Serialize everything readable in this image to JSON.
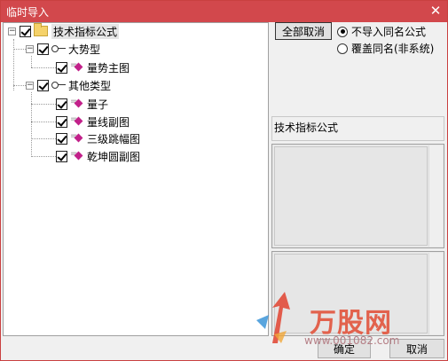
{
  "window": {
    "title": "临时导入",
    "close_glyph": "✕"
  },
  "tree": {
    "root": {
      "label": "技术指标公式",
      "checked": true,
      "expanded": true
    },
    "groups": [
      {
        "label": "大势型",
        "checked": true,
        "expanded": true,
        "items": [
          {
            "label": "量势主图",
            "checked": true
          }
        ]
      },
      {
        "label": "其他类型",
        "checked": true,
        "expanded": true,
        "items": [
          {
            "label": "量子",
            "checked": true
          },
          {
            "label": "量线副图",
            "checked": true
          },
          {
            "label": "三级跳幅图",
            "checked": true
          },
          {
            "label": "乾坤圆副图",
            "checked": true
          }
        ]
      }
    ]
  },
  "controls": {
    "deselect_all": "全部取消",
    "radio_no_import": "不导入同名公式",
    "radio_overwrite": "覆盖同名(非系统)",
    "selected_radio": "no_import",
    "info_label": "技术指标公式"
  },
  "footer": {
    "confirm": "确定",
    "cancel": "取消"
  },
  "watermark": {
    "brand": "万股网",
    "url": "www.001082.com"
  },
  "colors": {
    "titlebar": "#d2484c",
    "formula_icon": "#c2218a",
    "watermark": "#e2624d"
  }
}
